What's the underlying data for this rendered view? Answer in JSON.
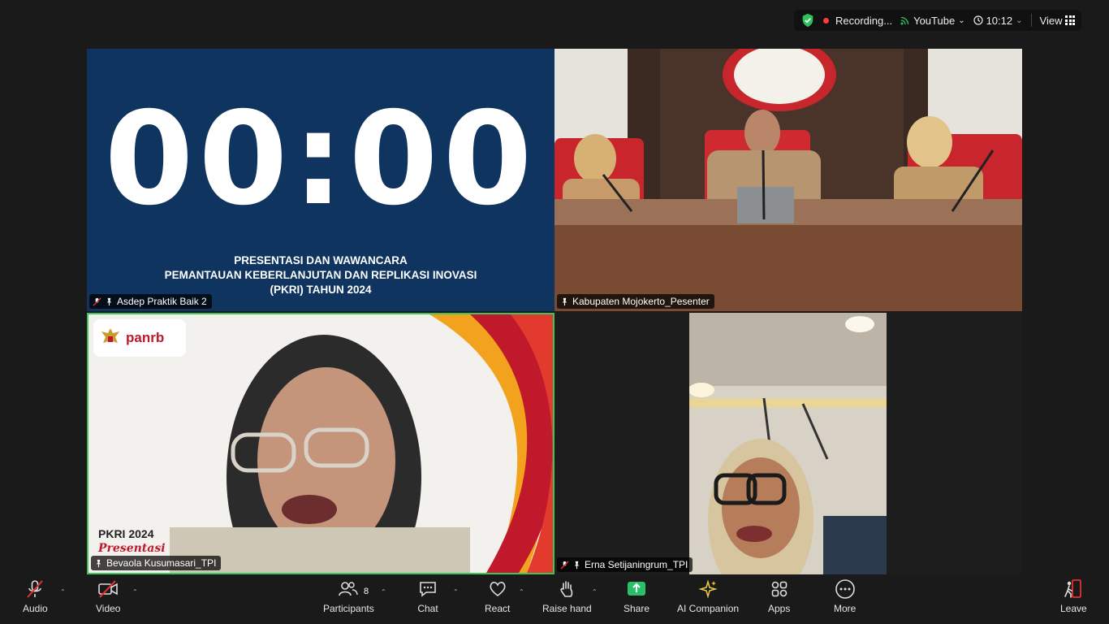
{
  "topbar": {
    "recording": "Recording...",
    "stream": "YouTube",
    "time": "10:12",
    "view": "View"
  },
  "tiles": {
    "t1": {
      "timer": "00:00",
      "title_line1": "PRESENTASI DAN WAWANCARA",
      "title_line2": "PEMANTAUAN KEBERLANJUTAN DAN REPLIKASI INOVASI",
      "title_line3": "(PKRI) TAHUN 2024",
      "name": "Asdep Praktik Baik 2"
    },
    "t2": {
      "name": "Kabupaten Mojokerto_Pesenter"
    },
    "t3": {
      "brand": "panrb",
      "pkri": "PKRI 2024",
      "pkri_sub": "Presentasi",
      "name": "Bevaola Kusumasari_TPI"
    },
    "t4": {
      "name": "Erna Setijaningrum_TPI"
    }
  },
  "toolbar": {
    "audio": "Audio",
    "video": "Video",
    "participants": "Participants",
    "participants_count": "8",
    "chat": "Chat",
    "react": "React",
    "raise_hand": "Raise hand",
    "share": "Share",
    "ai_companion": "AI Companion",
    "apps": "Apps",
    "more": "More",
    "leave": "Leave"
  },
  "colors": {
    "active_speaker": "#3cc55a",
    "share_green": "#29c06a",
    "recording_red": "#ff3b3b",
    "leave_red": "#e5312f"
  }
}
